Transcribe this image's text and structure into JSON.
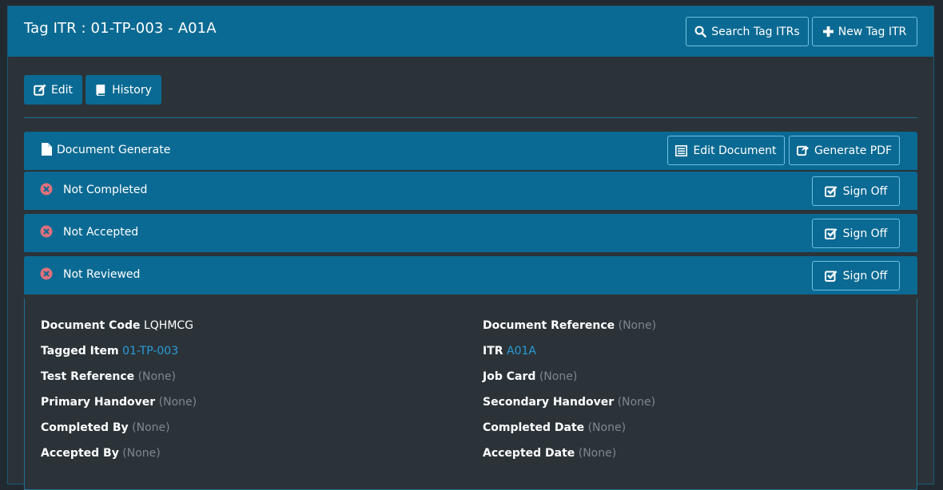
{
  "header": {
    "title": "Tag ITR : 01-TP-003 - A01A",
    "search_label": "Search Tag ITRs",
    "new_label": "New Tag ITR"
  },
  "toolbar": {
    "edit_label": "Edit",
    "history_label": "History"
  },
  "document": {
    "label": "Document Generate",
    "edit_document_label": "Edit Document",
    "generate_pdf_label": "Generate PDF"
  },
  "statuses": [
    {
      "label": "Not Completed",
      "button": "Sign Off"
    },
    {
      "label": "Not Accepted",
      "button": "Sign Off"
    },
    {
      "label": "Not Reviewed",
      "button": "Sign Off"
    }
  ],
  "fields_left": [
    {
      "label": "Document Code",
      "value": "LQHMCG",
      "kind": "val"
    },
    {
      "label": "Tagged Item",
      "value": "01-TP-003",
      "kind": "link"
    },
    {
      "label": "Test Reference",
      "value": "(None)",
      "kind": "none"
    },
    {
      "label": "Primary Handover",
      "value": "(None)",
      "kind": "none"
    },
    {
      "label": "Completed By",
      "value": "(None)",
      "kind": "none"
    },
    {
      "label": "Accepted By",
      "value": "(None)",
      "kind": "none"
    }
  ],
  "fields_right": [
    {
      "label": "Document Reference",
      "value": "(None)",
      "kind": "none"
    },
    {
      "label": "ITR",
      "value": "A01A",
      "kind": "link"
    },
    {
      "label": "Job Card",
      "value": "(None)",
      "kind": "none"
    },
    {
      "label": "Secondary Handover",
      "value": "(None)",
      "kind": "none"
    },
    {
      "label": "Completed Date",
      "value": "(None)",
      "kind": "none"
    },
    {
      "label": "Accepted Date",
      "value": "(None)",
      "kind": "none"
    }
  ],
  "colors": {
    "primary": "#0b6a93",
    "background": "#2b3338",
    "link": "#2a9bd8",
    "muted": "#7f878d",
    "status_icon": "#e0707c"
  }
}
